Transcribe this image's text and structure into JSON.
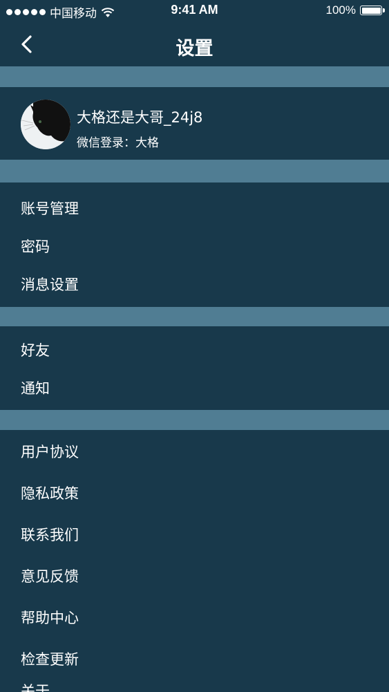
{
  "status_bar": {
    "carrier": "中国移动",
    "time": "9:41 AM",
    "battery": "100%",
    "signal_icon": "signal-dots-icon",
    "wifi_icon": "wifi-icon",
    "battery_icon": "battery-icon"
  },
  "nav": {
    "title": "设置",
    "back_icon": "chevron-left-icon"
  },
  "profile": {
    "name": "大格还是大哥_24j8",
    "login_info": "微信登录：大格"
  },
  "groups": {
    "account": [
      "账号管理",
      "密码",
      "消息设置"
    ],
    "social": [
      "好友",
      "通知"
    ],
    "about": [
      "用户协议",
      "隐私政策",
      "联系我们",
      "意见反馈",
      "帮助中心",
      "检查更新",
      "关于"
    ]
  },
  "colors": {
    "background": "#18394b",
    "separator": "#507d93",
    "text": "#ffffff"
  }
}
